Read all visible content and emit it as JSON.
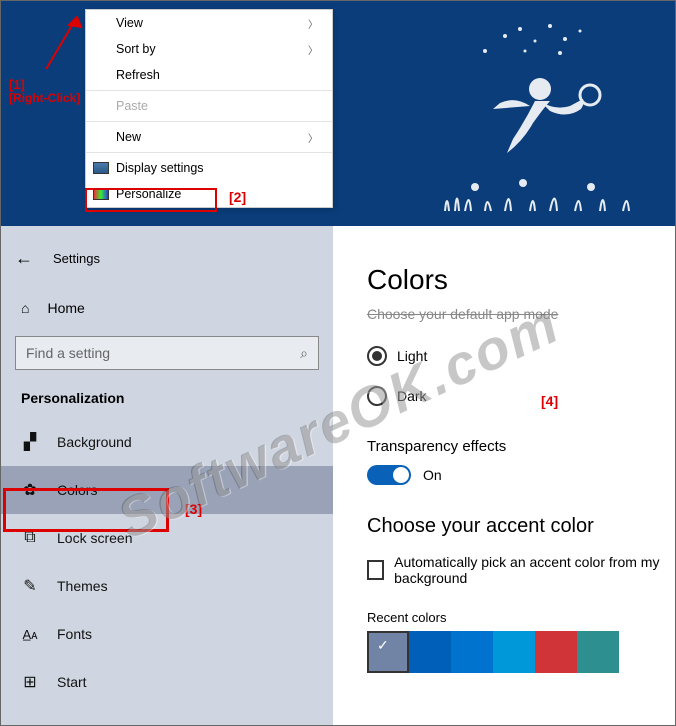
{
  "annotations": {
    "step1_num": "[1]",
    "step1_text": "[Right-Click]",
    "step2_num": "[2]",
    "step3_num": "[3]",
    "step4_num": "[4]"
  },
  "context_menu": {
    "view": "View",
    "sort_by": "Sort by",
    "refresh": "Refresh",
    "paste": "Paste",
    "new": "New",
    "display_settings": "Display settings",
    "personalize": "Personalize"
  },
  "settings": {
    "title": "Settings",
    "home": "Home",
    "search_placeholder": "Find a setting",
    "category": "Personalization",
    "nav": {
      "background": "Background",
      "colors": "Colors",
      "lock_screen": "Lock screen",
      "themes": "Themes",
      "fonts": "Fonts",
      "start": "Start"
    }
  },
  "colors_page": {
    "title": "Colors",
    "choose_mode": "Choose your default app mode",
    "light": "Light",
    "dark": "Dark",
    "transparency": "Transparency effects",
    "toggle_on": "On",
    "accent_heading": "Choose your accent color",
    "auto_pick": "Automatically pick an accent color from my background",
    "recent_colors": "Recent colors",
    "swatches": [
      "#7284a6",
      "#005fb8",
      "#0073cf",
      "#0098d9",
      "#d13438",
      "#2d8f8f"
    ]
  },
  "watermark": "SoftwareOK.com"
}
